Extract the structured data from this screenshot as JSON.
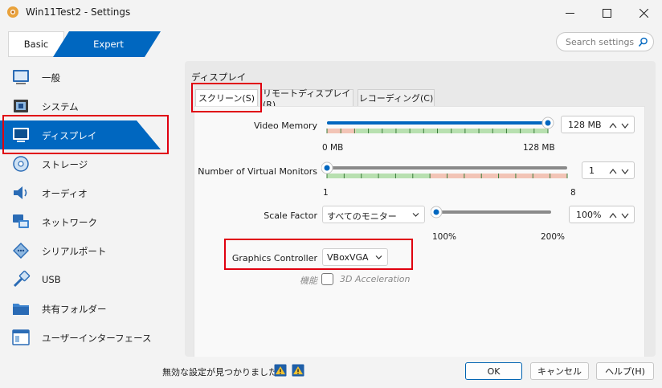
{
  "window": {
    "title": "Win11Test2 - Settings"
  },
  "mode": {
    "basic": "Basic",
    "expert": "Expert"
  },
  "search": {
    "placeholder": "Search settings"
  },
  "sidebar": {
    "items": [
      {
        "label": "一般",
        "icon": "general-icon"
      },
      {
        "label": "システム",
        "icon": "system-chip-icon"
      },
      {
        "label": "ディスプレイ",
        "icon": "display-monitor-icon",
        "active": true
      },
      {
        "label": "ストレージ",
        "icon": "storage-disc-icon"
      },
      {
        "label": "オーディオ",
        "icon": "audio-speaker-icon"
      },
      {
        "label": "ネットワーク",
        "icon": "network-icon"
      },
      {
        "label": "シリアルポート",
        "icon": "serial-port-icon"
      },
      {
        "label": "USB",
        "icon": "usb-icon"
      },
      {
        "label": "共有フォルダー",
        "icon": "shared-folder-icon"
      },
      {
        "label": "ユーザーインターフェース",
        "icon": "user-interface-icon"
      }
    ]
  },
  "display": {
    "title": "ディスプレイ",
    "tabs": [
      "スクリーン(S)",
      "リモートディスプレイ(R)",
      "レコーディング(C)"
    ],
    "video_memory": {
      "label": "Video Memory",
      "value": "128 MB",
      "min_label": "0 MB",
      "max_label": "128 MB",
      "fraction": 1.0
    },
    "monitors": {
      "label": "Number of Virtual Monitors",
      "value": "1",
      "min_label": "1",
      "max_label": "8",
      "fraction": 0.0
    },
    "scale": {
      "label": "Scale Factor",
      "combo": "すべてのモニター",
      "value": "100%",
      "min_label": "100%",
      "max_label": "200%",
      "fraction": 0.0
    },
    "graphics_controller": {
      "label": "Graphics Controller",
      "value": "VBoxVGA"
    },
    "features": {
      "label": "機能",
      "accel_label": "3D Acceleration",
      "accel_checked": false
    }
  },
  "footer": {
    "message": "無効な設定が見つかりました",
    "ok": "OK",
    "cancel": "キャンセル",
    "help": "ヘルプ(H)"
  },
  "colors": {
    "accent": "#0067c0",
    "highlight": "#e0000f",
    "slider_green": "#b8e0b0",
    "slider_red": "#f2c4b6"
  }
}
